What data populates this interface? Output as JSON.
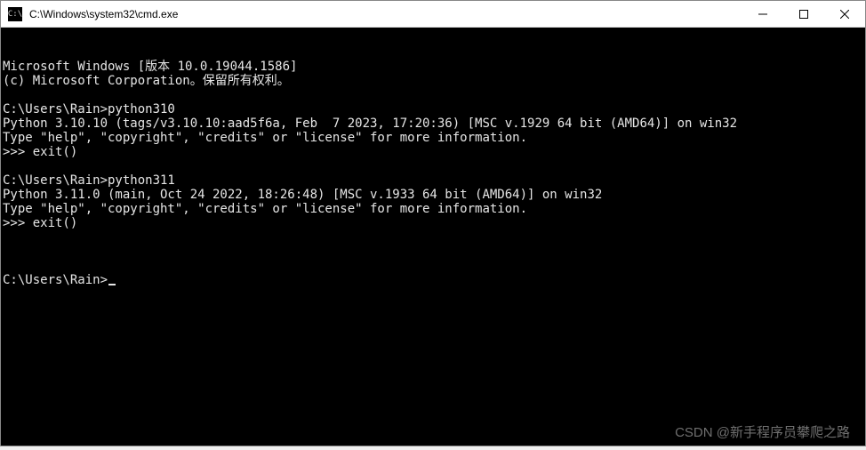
{
  "titlebar": {
    "icon_text": "C:\\",
    "title": "C:\\Windows\\system32\\cmd.exe"
  },
  "terminal": {
    "lines": [
      "Microsoft Windows [版本 10.0.19044.1586]",
      "(c) Microsoft Corporation。保留所有权利。",
      "",
      "C:\\Users\\Rain>python310",
      "Python 3.10.10 (tags/v3.10.10:aad5f6a, Feb  7 2023, 17:20:36) [MSC v.1929 64 bit (AMD64)] on win32",
      "Type \"help\", \"copyright\", \"credits\" or \"license\" for more information.",
      ">>> exit()",
      "",
      "C:\\Users\\Rain>python311",
      "Python 3.11.0 (main, Oct 24 2022, 18:26:48) [MSC v.1933 64 bit (AMD64)] on win32",
      "Type \"help\", \"copyright\", \"credits\" or \"license\" for more information.",
      ">>> exit()",
      ""
    ],
    "prompt": "C:\\Users\\Rain>"
  },
  "watermark": "CSDN @新手程序员攀爬之路"
}
